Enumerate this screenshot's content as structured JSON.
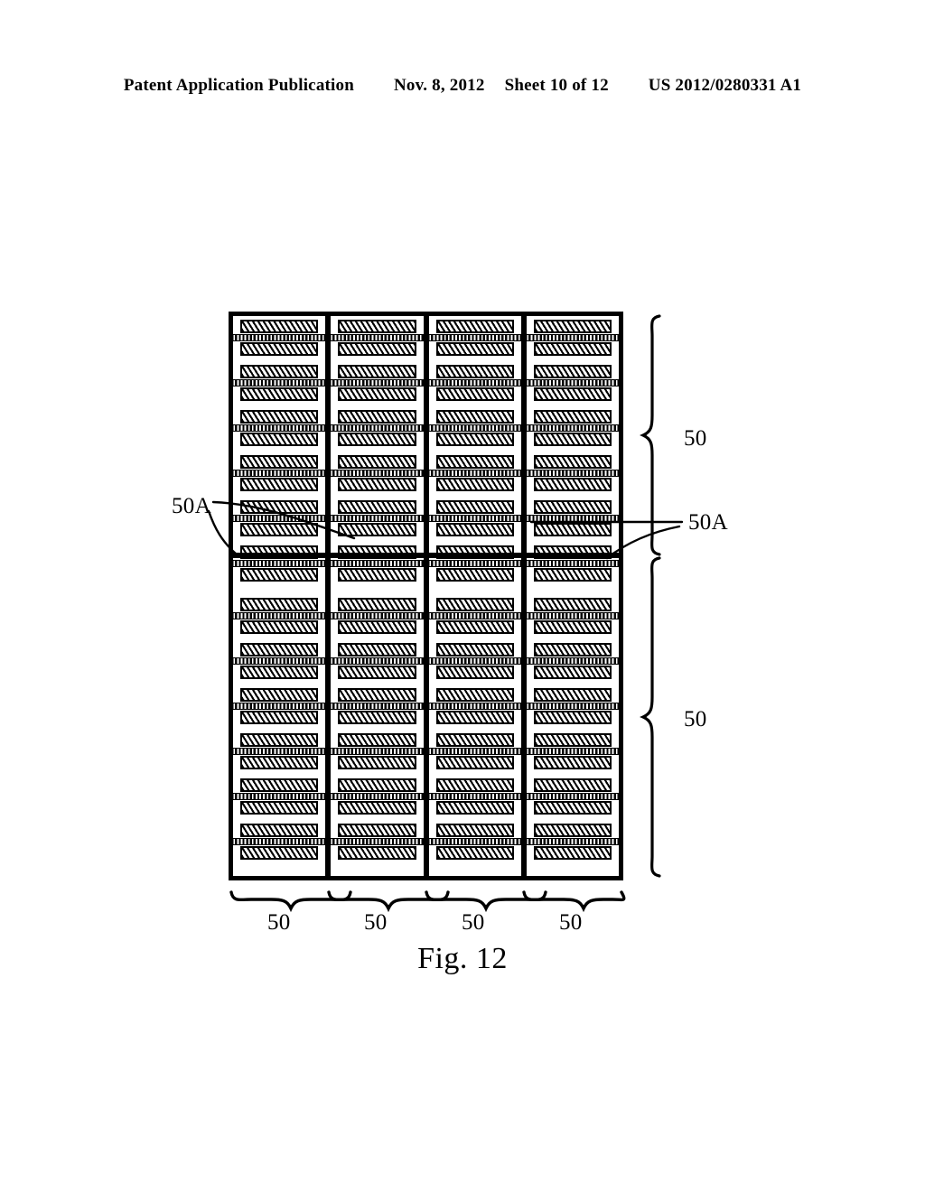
{
  "header": {
    "publication": "Patent Application Publication",
    "date": "Nov. 8, 2012",
    "sheet": "Sheet 10 of 12",
    "publication_number": "US 2012/0280331 A1"
  },
  "figure": {
    "caption": "Fig. 12",
    "description": "Cross-sectional schematic of a repeating multi-layer stack array arranged in four vertical columns and two horizontal sections",
    "grid": {
      "columns": 4,
      "sections": 2,
      "units_per_section_per_column": 6,
      "unit_parts": [
        "upper-hatched-bar",
        "stippled-connector-strip",
        "lower-hatched-bar"
      ]
    },
    "reference_numerals": {
      "left_50a": "50A",
      "right_50a": "50A",
      "right_brace_upper": "50",
      "right_brace_lower": "50",
      "bottom_brace_1": "50",
      "bottom_brace_2": "50",
      "bottom_brace_3": "50",
      "bottom_brace_4": "50"
    }
  },
  "colors": {
    "ink": "#000000",
    "paper": "#ffffff"
  }
}
